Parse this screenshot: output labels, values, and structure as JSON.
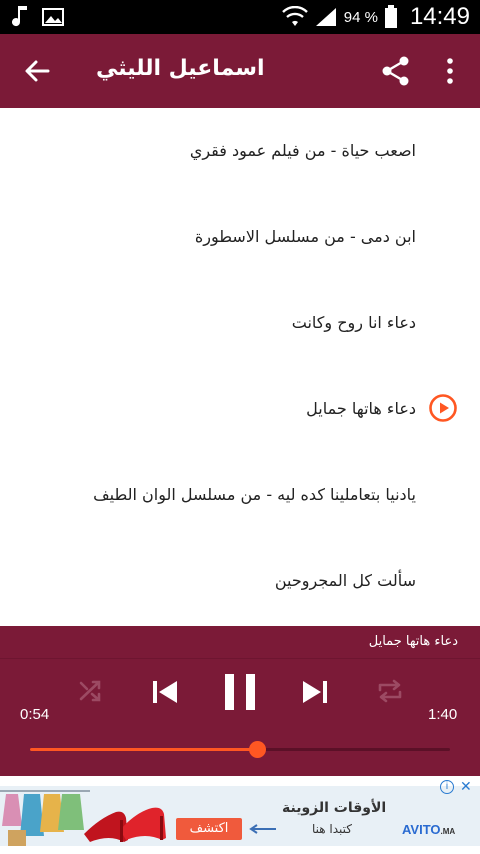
{
  "status_bar": {
    "battery_percent": "94 %",
    "time": "14:49",
    "icons": [
      "music-note-icon",
      "image-icon",
      "wifi-icon",
      "signal-icon",
      "battery-icon"
    ]
  },
  "app_bar": {
    "title": "اسماعيل الليثي",
    "icons": [
      "back-arrow-icon",
      "share-icon",
      "more-vert-icon"
    ]
  },
  "tracks": [
    {
      "title": "اصعب حياة - من فيلم عمود فقري",
      "playing": false
    },
    {
      "title": "ابن دمى - من مسلسل الاسطورة",
      "playing": false
    },
    {
      "title": "دعاء انا روح وكانت",
      "playing": false
    },
    {
      "title": "دعاء هاتها جمايل",
      "playing": true
    },
    {
      "title": "يادنيا بتعاملينا كده ليه - من مسلسل الوان الطيف",
      "playing": false
    },
    {
      "title": "سألت كل المجروحين",
      "playing": false
    }
  ],
  "player": {
    "now_playing": "دعاء هاتها جمايل",
    "elapsed": "0:54",
    "duration": "1:40",
    "progress": 0.54,
    "icons": [
      "shuffle-icon",
      "previous-icon",
      "pause-icon",
      "next-icon",
      "repeat-icon"
    ]
  },
  "ad": {
    "headline": "الأوقات الزوينة",
    "subline": "كتبدا هنا",
    "cta": "اكتشف",
    "brand": "AVITO",
    "brand_suffix": ".MA",
    "info": "i",
    "close": "✕"
  },
  "colors": {
    "primary": "#7b1a37",
    "accent": "#ff5722",
    "status_bar": "#000000"
  }
}
